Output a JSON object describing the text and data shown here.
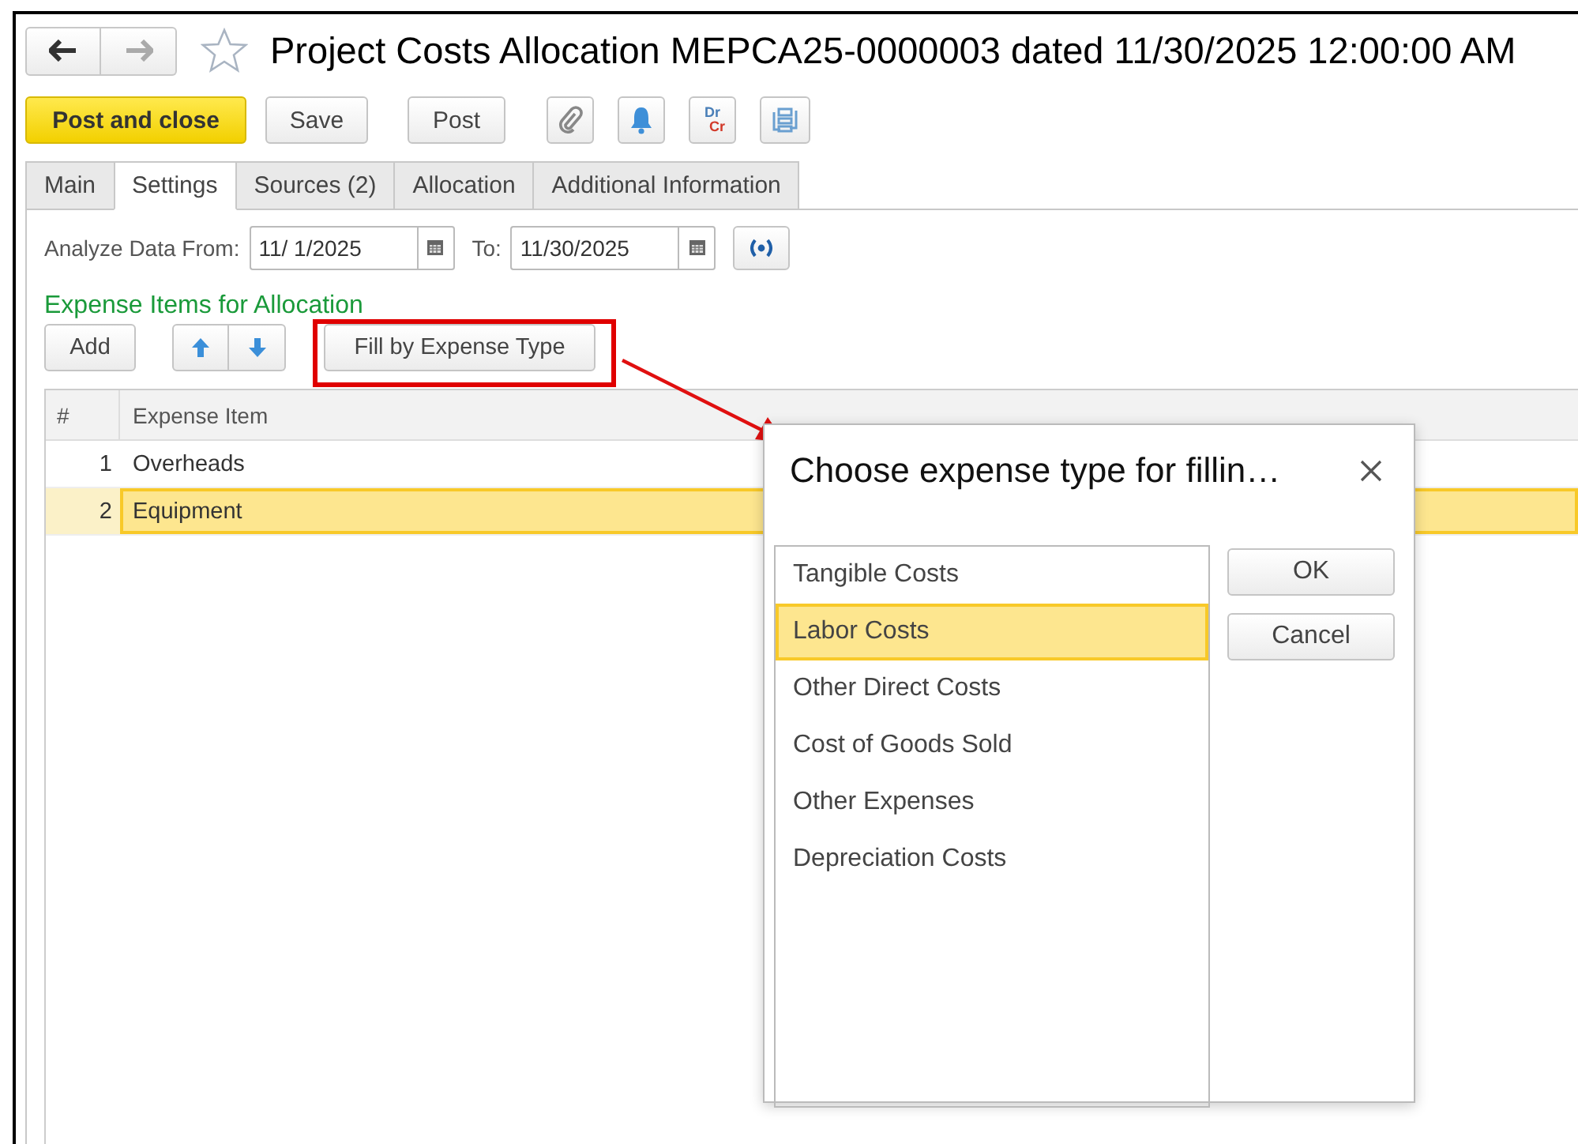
{
  "window": {
    "title": "Project Costs Allocation MEPCA25-0000003 dated 11/30/2025 12:00:00 AM",
    "favorite": false
  },
  "toolbar": {
    "buttons": [
      {
        "label": "Post and close",
        "kind": "primary"
      },
      {
        "label": "Save",
        "kind": "plain"
      },
      {
        "label": "Post",
        "kind": "plain"
      }
    ],
    "icons": [
      {
        "kind": "paperclip"
      },
      {
        "kind": "bell"
      },
      {
        "kind": "drcr",
        "lines": [
          "Dr",
          "Cr"
        ]
      },
      {
        "kind": "structure"
      }
    ]
  },
  "tabs": [
    {
      "label": "Main",
      "selected": false
    },
    {
      "label": "Settings",
      "selected": true
    },
    {
      "label": "Sources (2)",
      "selected": false
    },
    {
      "label": "Allocation",
      "selected": false
    },
    {
      "label": "Additional Information",
      "selected": false
    }
  ],
  "period": {
    "from_label": "Analyze Data From:",
    "from": "11/ 1/2025",
    "to_label": "To:",
    "to": "11/30/2025"
  },
  "section": {
    "title": "Expense Items for Allocation",
    "add_button": "Add",
    "fill_button": "Fill by Expense Type",
    "fill_highlighted": true
  },
  "table": {
    "columns": [
      "#",
      "Expense Item"
    ],
    "rows": [
      {
        "number": "1",
        "item": "Overheads",
        "selected": false
      },
      {
        "number": "2",
        "item": "Equipment",
        "selected": true
      }
    ]
  },
  "dialog": {
    "title": "Choose expense type for fillin…",
    "items": [
      {
        "label": "Tangible Costs",
        "selected": false
      },
      {
        "label": "Labor Costs",
        "selected": true
      },
      {
        "label": "Other Direct Costs",
        "selected": false
      },
      {
        "label": "Cost of Goods Sold",
        "selected": false
      },
      {
        "label": "Other Expenses",
        "selected": false
      },
      {
        "label": "Depreciation Costs",
        "selected": false
      }
    ],
    "buttons": [
      "OK",
      "Cancel"
    ]
  }
}
